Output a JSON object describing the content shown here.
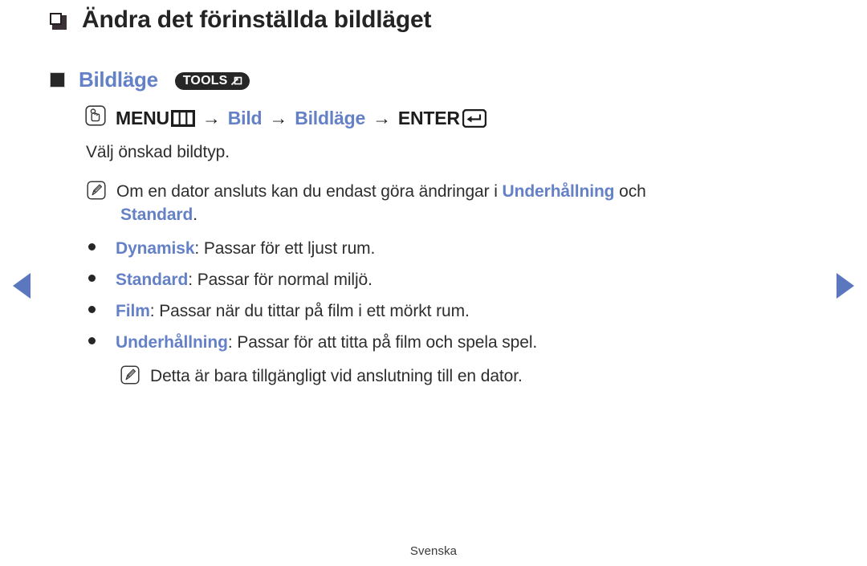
{
  "page": {
    "title": "Ändra det förinställda bildläget",
    "footer_language": "Svenska"
  },
  "section": {
    "title": "Bildläge",
    "tools_badge": "TOOLS"
  },
  "nav_path": {
    "press_icon": "press-button-icon",
    "menu_label": "MENU",
    "menu_glyph_icon": "menu-bars-icon",
    "arrow_1": "→",
    "step_1": "Bild",
    "arrow_2": "→",
    "step_2": "Bildläge",
    "arrow_3": "→",
    "enter_label": "ENTER",
    "enter_glyph_icon": "enter-key-icon"
  },
  "instruction": "Välj önskad bildtyp.",
  "notes": [
    {
      "icon": "note-pencil-icon",
      "text_before": "Om en dator ansluts kan du endast göra ändringar i ",
      "highlight": "Underhållning",
      "text_after": " och",
      "continuation_highlight": "Standard",
      "continuation_after": "."
    },
    {
      "icon": "note-pencil-icon",
      "text": "Detta är bara tillgängligt vid anslutning till en dator."
    }
  ],
  "bullets": [
    {
      "term": "Dynamisk",
      "description": ": Passar för ett ljust rum."
    },
    {
      "term": "Standard",
      "description": ": Passar för normal miljö."
    },
    {
      "term": "Film",
      "description": ": Passar när du tittar på film i ett mörkt rum."
    },
    {
      "term": "Underhållning",
      "description": ": Passar för att titta på film och spela spel."
    }
  ],
  "navigation": {
    "prev_icon": "previous-page-arrow-icon",
    "next_icon": "next-page-arrow-icon"
  },
  "colors": {
    "accent_blue": "#6480c6",
    "arrow_blue": "#5b78bf",
    "text_dark": "#2e2e2e",
    "badge_dark": "#272727"
  }
}
